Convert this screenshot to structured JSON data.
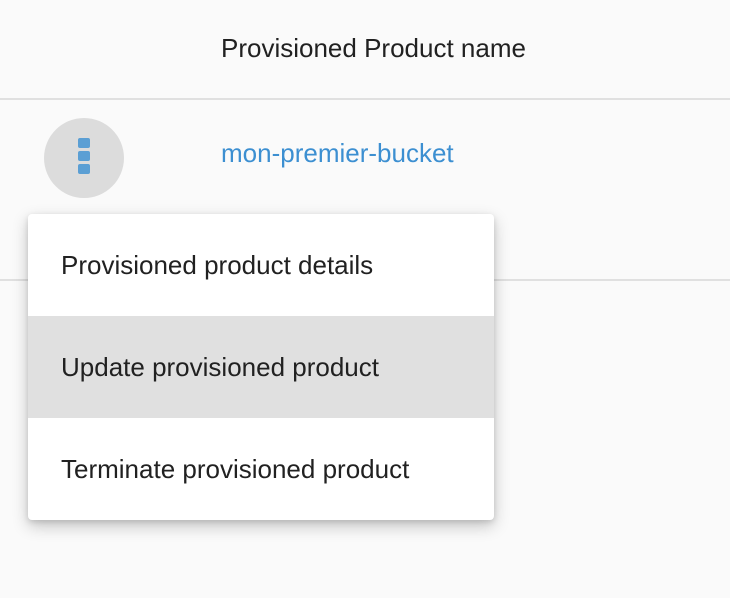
{
  "table": {
    "column_header": "Provisioned Product name",
    "rows": [
      {
        "name": "mon-premier-bucket"
      }
    ]
  },
  "row_actions": {
    "button_icon": "kebab-menu-icon",
    "menu": {
      "items": [
        {
          "label": "Provisioned product details",
          "highlighted": false
        },
        {
          "label": "Update provisioned product",
          "highlighted": true
        },
        {
          "label": "Terminate provisioned product",
          "highlighted": false
        }
      ]
    }
  },
  "colors": {
    "link": "#3c8fd1",
    "button_bg": "#dcdcdc",
    "icon": "#5b9fd4",
    "highlight": "#e0e0e0",
    "divider": "#e0e0e0"
  }
}
